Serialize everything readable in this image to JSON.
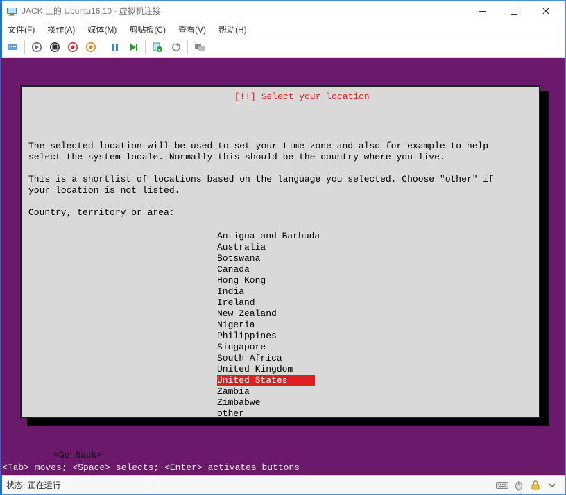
{
  "window": {
    "title": "JACK 上的 Ubuntu16.10 - 虚拟机连接"
  },
  "menus": {
    "file": "文件(F)",
    "action": "操作(A)",
    "media": "媒体(M)",
    "clipboard": "剪贴板(C)",
    "view": "查看(V)",
    "help": "帮助(H)"
  },
  "dialog": {
    "title": "[!!] Select your location",
    "body_line1": "The selected location will be used to set your time zone and also for example to help",
    "body_line2": "select the system locale. Normally this should be the country where you live.",
    "body_line3": "",
    "body_line4": "This is a shortlist of locations based on the language you selected. Choose \"other\" if",
    "body_line5": "your location is not listed.",
    "body_line6": "",
    "prompt": "Country, territory or area:",
    "go_back": "<Go Back>"
  },
  "options": [
    "Antigua and Barbuda",
    "Australia",
    "Botswana",
    "Canada",
    "Hong Kong",
    "India",
    "Ireland",
    "New Zealand",
    "Nigeria",
    "Philippines",
    "Singapore",
    "South Africa",
    "United Kingdom",
    "United States",
    "Zambia",
    "Zimbabwe",
    "other"
  ],
  "selected_index": 13,
  "hints": "<Tab> moves; <Space> selects; <Enter> activates buttons",
  "status": {
    "label": "状态:",
    "value": "正在运行"
  },
  "colors": {
    "purple": "#6b1a6b",
    "dialog_bg": "#d9d9d9",
    "red": "#e02020"
  }
}
